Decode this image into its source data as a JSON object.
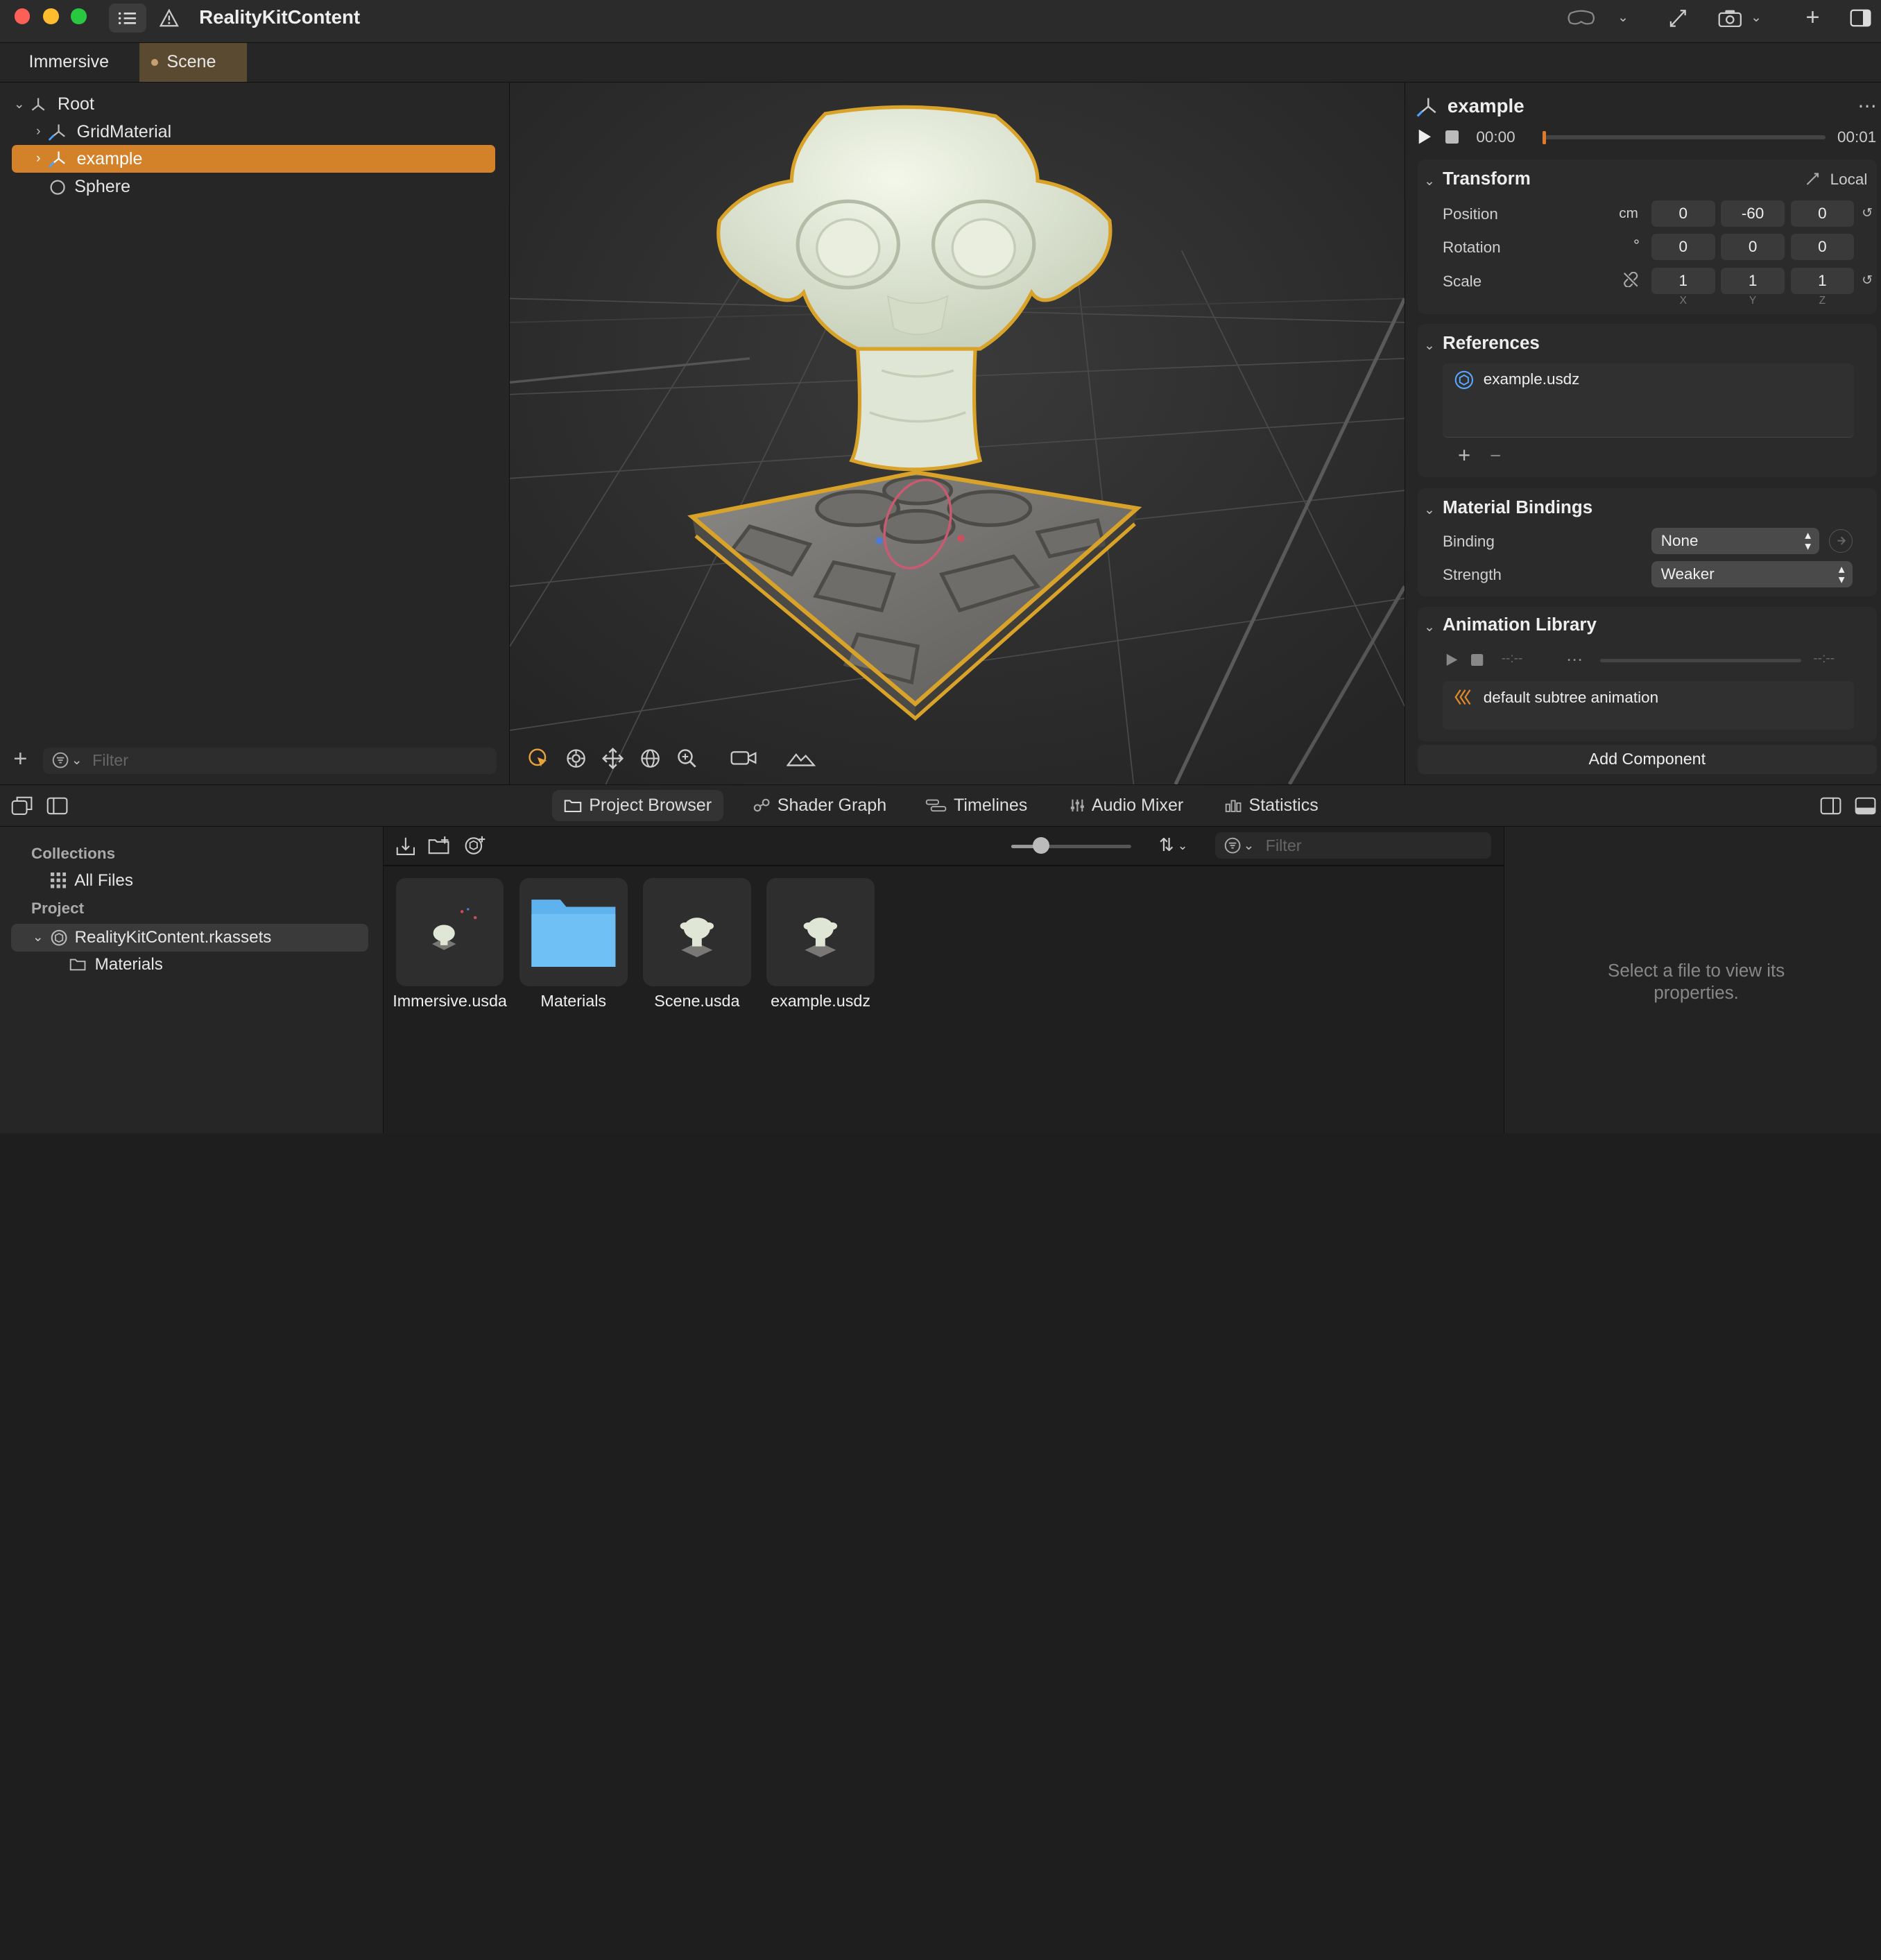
{
  "window": {
    "title": "RealityKitContent"
  },
  "tabs": [
    {
      "label": "Immersive"
    },
    {
      "label": "Scene"
    }
  ],
  "hierarchy": {
    "items": [
      {
        "label": "Root"
      },
      {
        "label": "GridMaterial"
      },
      {
        "label": "example"
      },
      {
        "label": "Sphere"
      }
    ],
    "filter_placeholder": "Filter"
  },
  "inspector": {
    "entity_name": "example",
    "time_start": "00:00",
    "time_end": "00:01",
    "transform": {
      "title": "Transform",
      "space": "Local",
      "position_label": "Position",
      "position_unit": "cm",
      "position": [
        "0",
        "-60",
        "0"
      ],
      "rotation_label": "Rotation",
      "rotation_unit": "°",
      "rotation": [
        "0",
        "0",
        "0"
      ],
      "scale_label": "Scale",
      "scale": [
        "1",
        "1",
        "1"
      ],
      "axes": [
        "X",
        "Y",
        "Z"
      ]
    },
    "references": {
      "title": "References",
      "file": "example.usdz"
    },
    "material_bindings": {
      "title": "Material Bindings",
      "binding_label": "Binding",
      "binding_value": "None",
      "strength_label": "Strength",
      "strength_value": "Weaker"
    },
    "animation_library": {
      "title": "Animation Library",
      "time_start": "--:--",
      "time_end": "--:--",
      "item": "default subtree animation"
    },
    "add_component": "Add Component"
  },
  "bottom_tabs": [
    {
      "label": "Project Browser"
    },
    {
      "label": "Shader Graph"
    },
    {
      "label": "Timelines"
    },
    {
      "label": "Audio Mixer"
    },
    {
      "label": "Statistics"
    }
  ],
  "collections": {
    "collections_heading": "Collections",
    "all_files": "All Files",
    "project_heading": "Project",
    "package": "RealityKitContent.rkassets",
    "materials": "Materials"
  },
  "browser": {
    "filter_placeholder": "Filter",
    "zoom_level": 0.25,
    "files": [
      {
        "name": "Immersive.usda"
      },
      {
        "name": "Materials"
      },
      {
        "name": "Scene.usda"
      },
      {
        "name": "example.usdz"
      }
    ]
  },
  "properties_empty": "Select a file to view its properties.",
  "colors": {
    "accent": "#c97a2a",
    "selection": "#d4822a",
    "outline": "#d9a32a"
  }
}
